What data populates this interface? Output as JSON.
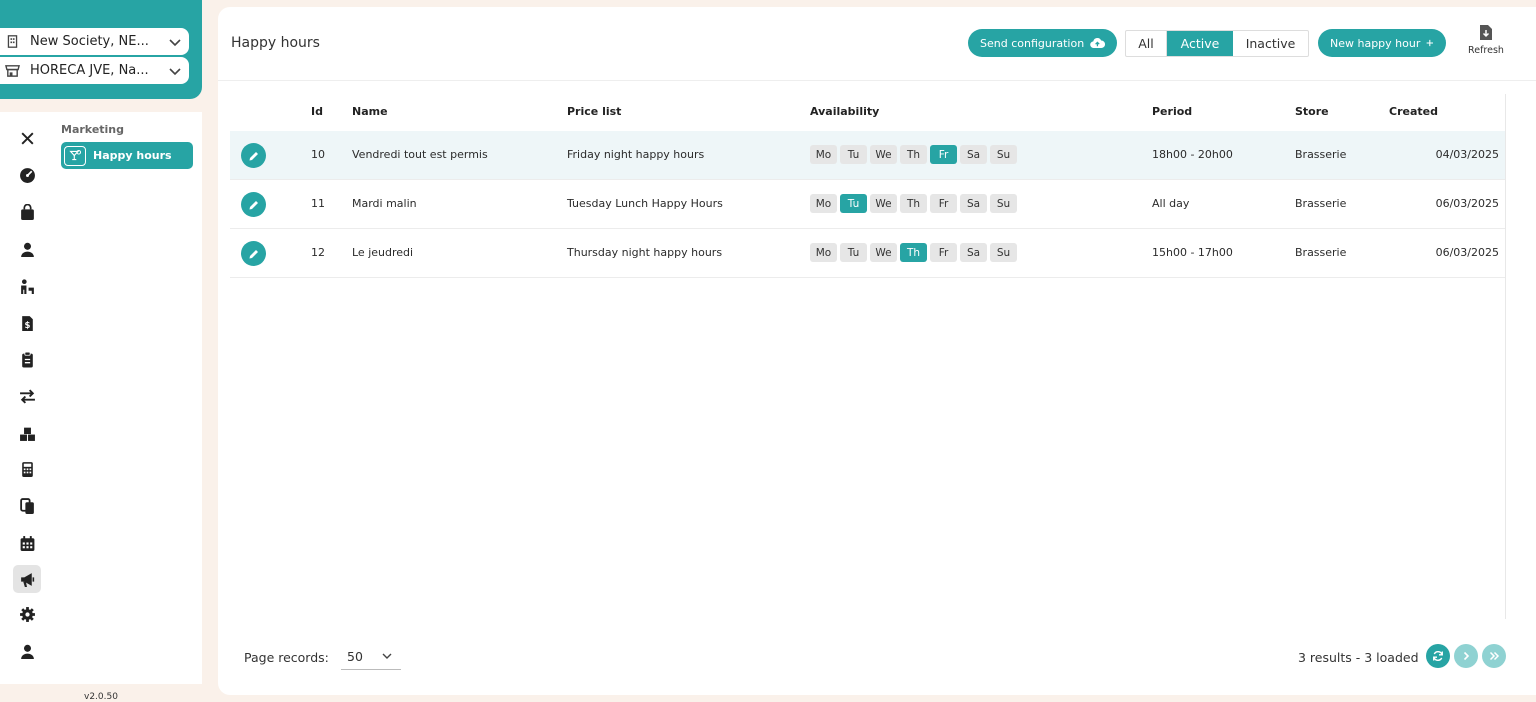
{
  "sidebar": {
    "society_selector": "New Society, NE...",
    "store_selector": "HORECA JVE, Na...",
    "section_title": "Marketing",
    "active_item": "Happy hours",
    "version": "v2.0.50",
    "rail_icons": [
      "close-icon",
      "dashboard-icon",
      "shopping-bag-icon",
      "user-icon",
      "staff-icon",
      "invoice-icon",
      "clipboard-icon",
      "transfer-icon",
      "boxes-icon",
      "calculator-icon",
      "copy-icon",
      "calendar-icon",
      "megaphone-icon",
      "settings-icon",
      "account-icon"
    ]
  },
  "header": {
    "title": "Happy hours",
    "send_configuration": "Send configuration",
    "filter_all": "All",
    "filter_active": "Active",
    "filter_inactive": "Inactive",
    "active_filter": "Active",
    "new_happy_hour": "New happy hour",
    "refresh": "Refresh"
  },
  "table": {
    "columns": {
      "id": "Id",
      "name": "Name",
      "price_list": "Price list",
      "availability": "Availability",
      "period": "Period",
      "store": "Store",
      "created": "Created"
    },
    "day_labels": [
      "Mo",
      "Tu",
      "We",
      "Th",
      "Fr",
      "Sa",
      "Su"
    ],
    "rows": [
      {
        "id": "10",
        "name": "Vendredi tout est permis",
        "price_list": "Friday night happy hours",
        "active_days": [
          "Fr"
        ],
        "period": "18h00 - 20h00",
        "store": "Brasserie",
        "created": "04/03/2025"
      },
      {
        "id": "11",
        "name": "Mardi malin",
        "price_list": "Tuesday Lunch Happy Hours",
        "active_days": [
          "Tu"
        ],
        "period": "All day",
        "store": "Brasserie",
        "created": "06/03/2025"
      },
      {
        "id": "12",
        "name": "Le jeudredi",
        "price_list": "Thursday night happy hours",
        "active_days": [
          "Th"
        ],
        "period": "15h00 - 17h00",
        "store": "Brasserie",
        "created": "06/03/2025"
      }
    ]
  },
  "footer": {
    "page_records_label": "Page records:",
    "page_records_value": "50",
    "results_text": "3 results - 3 loaded"
  },
  "colors": {
    "accent": "#27a4a4",
    "accent_light": "#8fd2d2",
    "background": "#faf1ea"
  }
}
